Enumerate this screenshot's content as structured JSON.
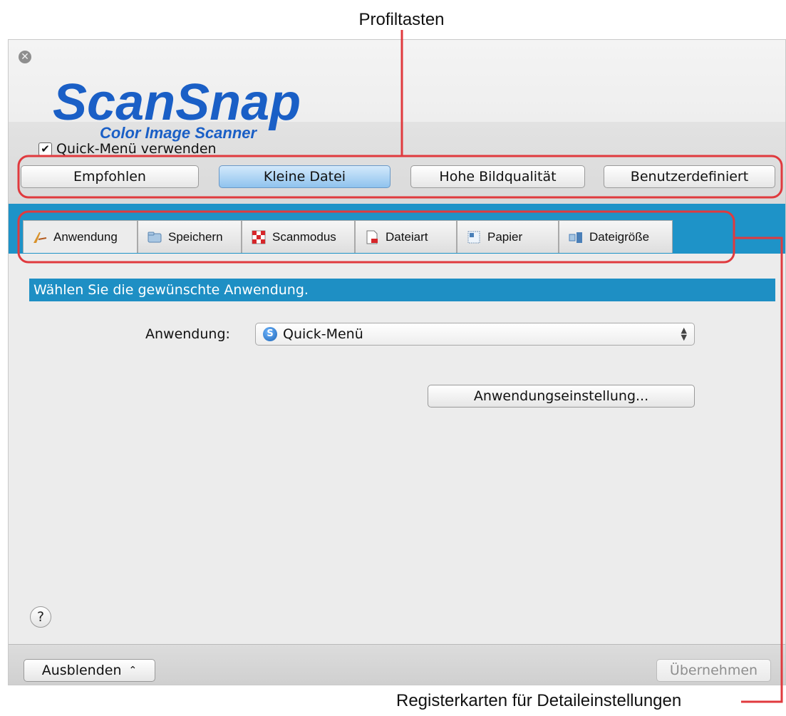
{
  "callouts": {
    "profile_keys": "Profiltasten",
    "detail_tabs": "Registerkarten für Detaileinstellungen"
  },
  "colors": {
    "accent": "#1e93c8",
    "callout": "#e03a3e"
  },
  "window": {
    "close_icon": "close-icon",
    "logo": {
      "brand": "ScanSnap",
      "tagline": "Color Image Scanner"
    },
    "quick_menu": {
      "label": "Quick-Menü verwenden",
      "checked": true
    },
    "profiles": [
      {
        "label": "Empfohlen",
        "active": false
      },
      {
        "label": "Kleine Datei",
        "active": true
      },
      {
        "label": "Hohe Bildqualität",
        "active": false
      },
      {
        "label": "Benutzerdefiniert",
        "active": false
      }
    ],
    "tabs": [
      {
        "label": "Anwendung",
        "icon": "application-icon",
        "selected": true
      },
      {
        "label": "Speichern",
        "icon": "folder-icon",
        "selected": false
      },
      {
        "label": "Scanmodus",
        "icon": "scan-mode-icon",
        "selected": false
      },
      {
        "label": "Dateiart",
        "icon": "file-type-icon",
        "selected": false
      },
      {
        "label": "Papier",
        "icon": "paper-icon",
        "selected": false
      },
      {
        "label": "Dateigröße",
        "icon": "file-size-icon",
        "selected": false
      }
    ],
    "section_title": "Wählen Sie die gewünschte Anwendung.",
    "application": {
      "label": "Anwendung:",
      "value": "Quick-Menü",
      "settings_button": "Anwendungseinstellung..."
    },
    "help": "?",
    "footer": {
      "hide_button": "Ausblenden",
      "apply_button": "Übernehmen",
      "apply_enabled": false
    }
  }
}
